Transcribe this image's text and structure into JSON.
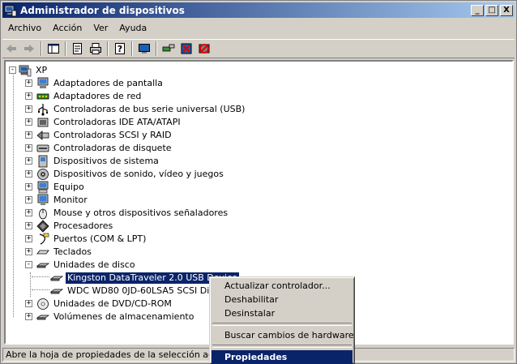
{
  "window": {
    "title": "Administrador de dispositivos",
    "buttons": {
      "minimize": "_",
      "maximize": "□",
      "close": "X"
    }
  },
  "menubar": [
    "Archivo",
    "Acción",
    "Ver",
    "Ayuda"
  ],
  "toolbar": [
    "back-icon",
    "forward-icon",
    "show-hide-tree-icon",
    "properties-icon",
    "print-icon",
    "help-icon",
    "view-icon",
    "scan-hardware-icon",
    "uninstall-icon",
    "disable-icon"
  ],
  "tree": {
    "root": "XP",
    "items": [
      {
        "label": "Adaptadores de pantalla",
        "icon": "display-adapter-icon"
      },
      {
        "label": "Adaptadores de red",
        "icon": "network-adapter-icon"
      },
      {
        "label": "Controladoras de bus serie universal (USB)",
        "icon": "usb-icon"
      },
      {
        "label": "Controladoras IDE ATA/ATAPI",
        "icon": "ide-controller-icon"
      },
      {
        "label": "Controladoras SCSI y RAID",
        "icon": "scsi-icon"
      },
      {
        "label": "Controladoras de disquete",
        "icon": "floppy-controller-icon"
      },
      {
        "label": "Dispositivos de sistema",
        "icon": "system-device-icon"
      },
      {
        "label": "Dispositivos de sonido, vídeo y juegos",
        "icon": "sound-icon"
      },
      {
        "label": "Equipo",
        "icon": "computer-icon"
      },
      {
        "label": "Monitor",
        "icon": "monitor-icon"
      },
      {
        "label": "Mouse y otros dispositivos señaladores",
        "icon": "mouse-icon"
      },
      {
        "label": "Procesadores",
        "icon": "processor-icon"
      },
      {
        "label": "Puertos (COM & LPT)",
        "icon": "port-icon"
      },
      {
        "label": "Teclados",
        "icon": "keyboard-icon"
      },
      {
        "label": "Unidades de disco",
        "icon": "disk-drive-icon",
        "expanded": true,
        "children": [
          {
            "label": "Kingston DataTraveler 2.0 USB Device",
            "selected": true
          },
          {
            "label": "WDC WD80 0JD-60LSA5 SCSI Disk D"
          }
        ]
      },
      {
        "label": "Unidades de DVD/CD-ROM",
        "icon": "cdrom-icon"
      },
      {
        "label": "Volúmenes de almacenamiento",
        "icon": "volume-icon"
      }
    ]
  },
  "context_menu": {
    "items": [
      {
        "label": "Actualizar controlador..."
      },
      {
        "label": "Deshabilitar"
      },
      {
        "label": "Desinstalar"
      },
      {
        "separator": true
      },
      {
        "label": "Buscar cambios de hardware"
      },
      {
        "separator": true
      },
      {
        "label": "Propiedades",
        "default": true,
        "highlighted": true
      }
    ]
  },
  "statusbar": {
    "text": "Abre la hoja de propiedades de la selección actual."
  }
}
